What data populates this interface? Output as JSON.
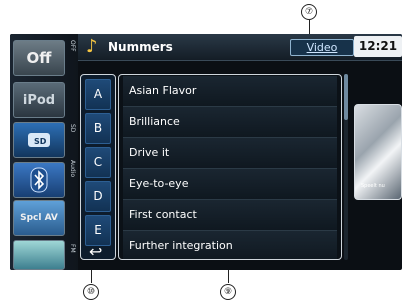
{
  "callouts": {
    "top": "⑦",
    "left_bottom": "⑩",
    "middle_bottom": "⑨"
  },
  "sources": [
    {
      "label": "Off",
      "tag": "OFF"
    },
    {
      "label": "iPod",
      "tag": ""
    },
    {
      "label": "SD",
      "tag": "SD"
    },
    {
      "label": "",
      "tag": "Audio"
    },
    {
      "label": "Spcl AV",
      "tag": ""
    },
    {
      "label": "",
      "tag": "FM"
    }
  ],
  "header": {
    "title": "Nummers",
    "video_tab": "Video",
    "clock": "12:21"
  },
  "alphabet": [
    "A",
    "B",
    "C",
    "D",
    "E"
  ],
  "tracks": [
    "Asian Flavor",
    "Brilliance",
    "Drive it",
    "Eye-to-eye",
    "First contact",
    "Further integration"
  ],
  "preview": {
    "text": "Speelt nu"
  },
  "icons": {
    "note": "music-note-icon",
    "back": "back-arrow-icon",
    "bluetooth": "bluetooth-icon",
    "sd": "sd-card-icon"
  }
}
